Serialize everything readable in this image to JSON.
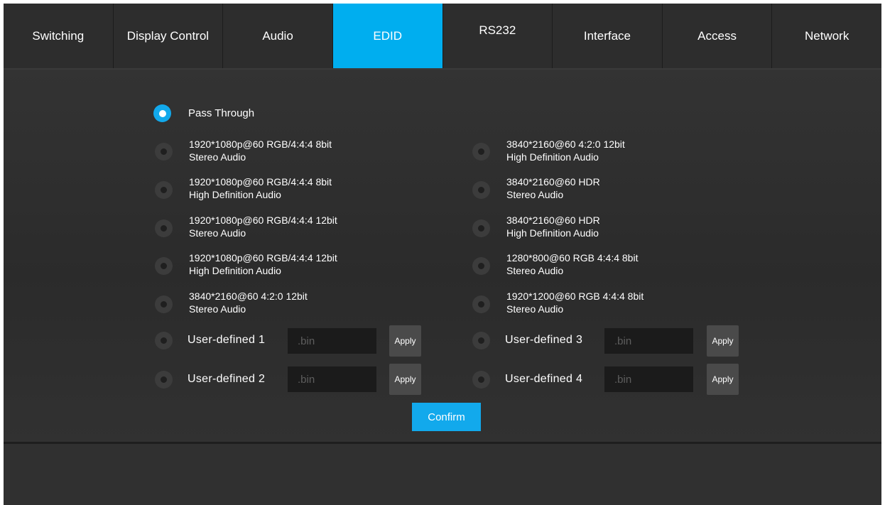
{
  "tabs": [
    {
      "label": "Switching"
    },
    {
      "label": "Display Control"
    },
    {
      "label": "Audio"
    },
    {
      "label": "EDID"
    },
    {
      "label": "RS232"
    },
    {
      "label": "Interface"
    },
    {
      "label": "Access"
    },
    {
      "label": "Network"
    }
  ],
  "active_tab": "EDID",
  "colors": {
    "accent": "#12a9ec",
    "tab_active": "#00aeef",
    "background": "#262626"
  },
  "edid": {
    "pass_through": {
      "label": "Pass Through",
      "selected": true
    },
    "left_options": [
      {
        "line1": "1920*1080p@60 RGB/4:4:4 8bit",
        "line2": "Stereo Audio"
      },
      {
        "line1": "1920*1080p@60 RGB/4:4:4 8bit",
        "line2": "High Definition Audio"
      },
      {
        "line1": "1920*1080p@60 RGB/4:4:4 12bit",
        "line2": "Stereo Audio"
      },
      {
        "line1": "1920*1080p@60 RGB/4:4:4 12bit",
        "line2": "High Definition Audio"
      },
      {
        "line1": "3840*2160@60 4:2:0 12bit",
        "line2": "Stereo Audio"
      }
    ],
    "right_options": [
      {
        "line1": "3840*2160@60 4:2:0 12bit",
        "line2": "High Definition Audio"
      },
      {
        "line1": "3840*2160@60 HDR",
        "line2": "Stereo Audio"
      },
      {
        "line1": "3840*2160@60 HDR",
        "line2": "High Definition Audio"
      },
      {
        "line1": "1280*800@60 RGB 4:4:4 8bit",
        "line2": "Stereo Audio"
      },
      {
        "line1": "1920*1200@60 RGB 4:4:4 8bit",
        "line2": "Stereo Audio"
      }
    ],
    "user_defined": [
      {
        "label": "User-defined 1",
        "placeholder": ".bin",
        "value": "",
        "apply": "Apply"
      },
      {
        "label": "User-defined 2",
        "placeholder": ".bin",
        "value": "",
        "apply": "Apply"
      },
      {
        "label": "User-defined 3",
        "placeholder": ".bin",
        "value": "",
        "apply": "Apply"
      },
      {
        "label": "User-defined 4",
        "placeholder": ".bin",
        "value": "",
        "apply": "Apply"
      }
    ],
    "confirm_label": "Confirm"
  }
}
